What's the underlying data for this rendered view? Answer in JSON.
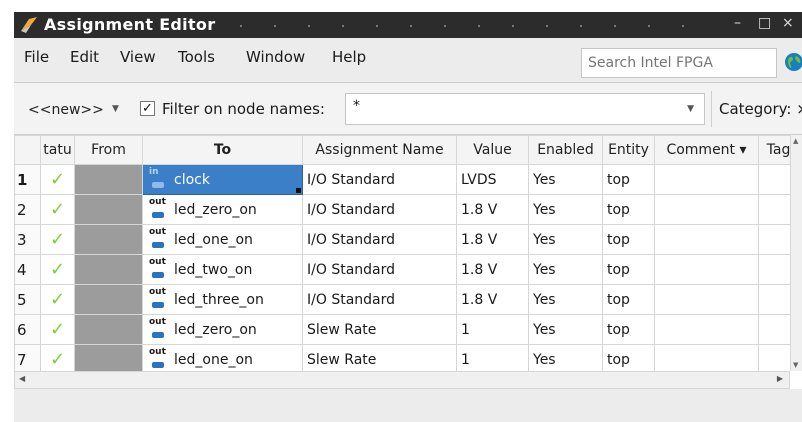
{
  "window": {
    "title": "Assignment Editor",
    "minimize_glyph": "–",
    "maximize_glyph": "□",
    "close_glyph": "×"
  },
  "menu": {
    "items": [
      "File",
      "Edit",
      "View",
      "Tools",
      "Window",
      "Help"
    ],
    "search_placeholder": "Search Intel FPGA"
  },
  "filter": {
    "new_list": "<<new>>",
    "checkbox_checked": true,
    "checkbox_glyph": "✓",
    "label": "Filter on node names:",
    "value": "*",
    "category_label": "Category: ×"
  },
  "table": {
    "headers": {
      "status": "tatu",
      "from": "From",
      "to": "To",
      "assignment_name": "Assignment Name",
      "value": "Value",
      "enabled": "Enabled",
      "entity": "Entity",
      "comment": "Comment ▾",
      "tag": "Tag"
    },
    "rows": [
      {
        "num": "1",
        "status": "✓",
        "from": "",
        "to_type": "in",
        "to": "clock",
        "assignment": "I/O Standard",
        "value": "LVDS",
        "enabled": "Yes",
        "entity": "top",
        "comment": "",
        "tag": ""
      },
      {
        "num": "2",
        "status": "✓",
        "from": "",
        "to_type": "out",
        "to": "led_zero_on",
        "assignment": "I/O Standard",
        "value": "1.8 V",
        "enabled": "Yes",
        "entity": "top",
        "comment": "",
        "tag": ""
      },
      {
        "num": "3",
        "status": "✓",
        "from": "",
        "to_type": "out",
        "to": "led_one_on",
        "assignment": "I/O Standard",
        "value": "1.8 V",
        "enabled": "Yes",
        "entity": "top",
        "comment": "",
        "tag": ""
      },
      {
        "num": "4",
        "status": "✓",
        "from": "",
        "to_type": "out",
        "to": "led_two_on",
        "assignment": "I/O Standard",
        "value": "1.8 V",
        "enabled": "Yes",
        "entity": "top",
        "comment": "",
        "tag": ""
      },
      {
        "num": "5",
        "status": "✓",
        "from": "",
        "to_type": "out",
        "to": "led_three_on",
        "assignment": "I/O Standard",
        "value": "1.8 V",
        "enabled": "Yes",
        "entity": "top",
        "comment": "",
        "tag": ""
      },
      {
        "num": "6",
        "status": "✓",
        "from": "",
        "to_type": "out",
        "to": "led_zero_on",
        "assignment": "Slew Rate",
        "value": "1",
        "enabled": "Yes",
        "entity": "top",
        "comment": "",
        "tag": ""
      },
      {
        "num": "7",
        "status": "✓",
        "from": "",
        "to_type": "out",
        "to": "led_one_on",
        "assignment": "Slew Rate",
        "value": "1",
        "enabled": "Yes",
        "entity": "top",
        "comment": "",
        "tag": ""
      }
    ],
    "selected_row": 0
  },
  "icons": {
    "app": "assignment-editor-icon",
    "globe": "globe-icon",
    "in_pin": "input-pin-icon",
    "out_pin": "output-pin-icon"
  },
  "colors": {
    "titlebar": "#2c2c2c",
    "selection": "#3a7fc8",
    "check": "#7bcf3e",
    "from_cell": "#9c9c9c"
  }
}
